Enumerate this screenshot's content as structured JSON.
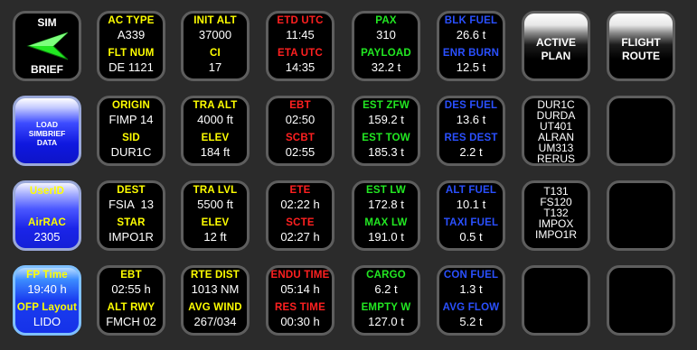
{
  "simbrief_logo": {
    "top": "SIM",
    "bottom": "BRIEF"
  },
  "ac_type": {
    "label": "AC TYPE",
    "value": "A339"
  },
  "flt_num": {
    "label": "FLT NUM",
    "value": "DE 1121"
  },
  "init_alt": {
    "label": "INIT ALT",
    "value": "37000"
  },
  "ci": {
    "label": "CI",
    "value": "17"
  },
  "etd_utc": {
    "label": "ETD UTC",
    "value": "11:45"
  },
  "eta_utc": {
    "label": "ETA UTC",
    "value": "14:35"
  },
  "pax": {
    "label": "PAX",
    "value": "310"
  },
  "payload": {
    "label": "PAYLOAD",
    "value": "32.2 t"
  },
  "blk_fuel": {
    "label": "BLK FUEL",
    "value": "26.6 t"
  },
  "enr_burn": {
    "label": "ENR BURN",
    "value": "12.5 t"
  },
  "active_plan": {
    "line1": "ACTIVE",
    "line2": "PLAN"
  },
  "flight_route": {
    "line1": "FLIGHT",
    "line2": "ROUTE"
  },
  "load_simbrief": {
    "line1": "LOAD",
    "line2": "SIMBRIEF",
    "line3": "DATA"
  },
  "origin": {
    "label": "ORIGIN",
    "value": "FIMP 14"
  },
  "sid": {
    "label": "SID",
    "value": "DUR1C"
  },
  "tra_alt": {
    "label": "TRA ALT",
    "value": "4000 ft"
  },
  "elev_origin": {
    "label": "ELEV",
    "value": "184 ft"
  },
  "ebt": {
    "label": "EBT",
    "value": "02:50"
  },
  "scbt": {
    "label": "SCBT",
    "value": "02:55"
  },
  "est_zfw": {
    "label": "EST ZFW",
    "value": "159.2 t"
  },
  "est_tow": {
    "label": "EST TOW",
    "value": "185.3 t"
  },
  "des_fuel": {
    "label": "DES FUEL",
    "value": "13.6 t"
  },
  "res_dest": {
    "label": "RES DEST",
    "value": "2.2 t"
  },
  "route_1": [
    "DUR1C",
    "DURDA",
    "UT401",
    "ALRAN",
    "UM313",
    "RERUS"
  ],
  "userid": {
    "label": "UserID",
    "airac_label": "AirRAC",
    "airac_value": "2305"
  },
  "dest": {
    "label": "DEST",
    "value": "FSIA  13"
  },
  "star": {
    "label": "STAR",
    "value": "IMPO1R"
  },
  "tra_lvl": {
    "label": "TRA LVL",
    "value": "5500 ft"
  },
  "elev_dest": {
    "label": "ELEV",
    "value": "12 ft"
  },
  "ete": {
    "label": "ETE",
    "value": "02:22 h"
  },
  "scte": {
    "label": "SCTE",
    "value": "02:27 h"
  },
  "est_lw": {
    "label": "EST LW",
    "value": "172.8 t"
  },
  "max_lw": {
    "label": "MAX LW",
    "value": "191.0 t"
  },
  "alt_fuel": {
    "label": "ALT FUEL",
    "value": "10.1 t"
  },
  "taxi_fuel": {
    "label": "TAXI FUEL",
    "value": "0.5 t"
  },
  "route_2": [
    "T131",
    "FS120",
    "T132",
    "IMPOX",
    "IMPO1R"
  ],
  "fp_time": {
    "label": "FP Time",
    "value": "19:40 h"
  },
  "ofp_layout": {
    "label": "OFP Layout",
    "value": "LIDO"
  },
  "ebt_h": {
    "label": "EBT",
    "value": "02:55 h"
  },
  "alt_rwy": {
    "label": "ALT RWY",
    "value": "FMCH 02"
  },
  "rte_dist": {
    "label": "RTE DIST",
    "value": "1013 NM"
  },
  "avg_wind": {
    "label": "AVG WIND",
    "value": "267/034"
  },
  "endu_time": {
    "label": "ENDU TIME",
    "value": "05:14 h"
  },
  "res_time": {
    "label": "RES TIME",
    "value": "00:30 h"
  },
  "cargo": {
    "label": "CARGO",
    "value": "6.2 t"
  },
  "empty_w": {
    "label": "EMPTY W",
    "value": "127.0 t"
  },
  "con_fuel": {
    "label": "CON FUEL",
    "value": "1.3 t"
  },
  "avg_flow": {
    "label": "AVG FLOW",
    "value": "5.2 t"
  },
  "colors": {
    "yellow": "#ffff00",
    "red": "#ff2020",
    "green": "#22e822",
    "blue": "#2a50ff",
    "tile_border": "#5e5e5e",
    "background": "#2b2b2b"
  }
}
